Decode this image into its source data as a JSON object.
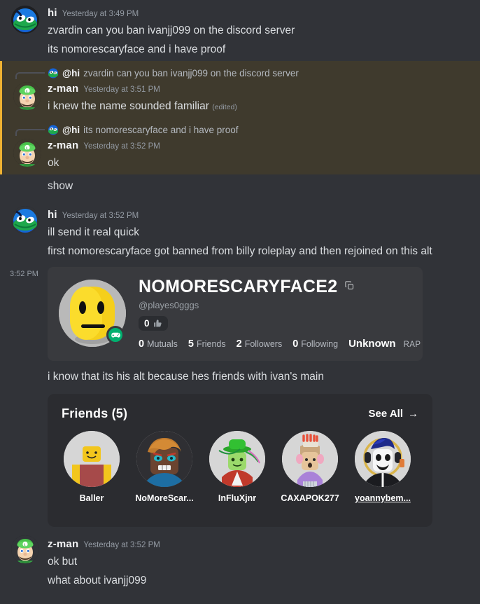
{
  "messages": [
    {
      "id": "m1",
      "author": "hi",
      "timestamp": "Yesterday at 3:49 PM",
      "avatar": "hi-avatar",
      "lines": [
        "zvardin can you ban ivanjj099 on the discord server",
        "its nomorescaryface and i have proof"
      ]
    },
    {
      "id": "m2",
      "author": "z-man",
      "timestamp": "Yesterday at 3:51 PM",
      "avatar": "z-man-avatar",
      "mention": true,
      "reply": {
        "name": "@hi",
        "text": "zvardin can you ban ivanjj099 on the discord server"
      },
      "lines": [
        "i knew the name sounded familiar"
      ],
      "edited": "(edited)"
    },
    {
      "id": "m3",
      "author": "z-man",
      "timestamp": "Yesterday at 3:52 PM",
      "avatar": "z-man-avatar",
      "mention": true,
      "reply": {
        "name": "@hi",
        "text": "its nomorescaryface and i have proof"
      },
      "lines": [
        "ok"
      ]
    },
    {
      "id": "m3b",
      "lines": [
        "show"
      ]
    },
    {
      "id": "m4",
      "author": "hi",
      "timestamp": "Yesterday at 3:52 PM",
      "avatar": "hi-avatar",
      "lines": [
        "ill send it real quick",
        "first nomorescaryface got banned from billy roleplay and then rejoined on this alt"
      ]
    }
  ],
  "embed": {
    "hover_timestamp": "3:52 PM",
    "profile": {
      "display_name": "NOMORESCARYFACE2",
      "handle": "@playes0gggs",
      "like_count": "0",
      "copy_icon": "copy-icon",
      "game_badge_icon": "gamepad-icon",
      "stats": [
        {
          "value": "0",
          "label": "Mutuals"
        },
        {
          "value": "5",
          "label": "Friends"
        },
        {
          "value": "2",
          "label": "Followers"
        },
        {
          "value": "0",
          "label": "Following"
        }
      ],
      "rap_value": "Unknown",
      "rap_label": "RAP"
    }
  },
  "mid_message": {
    "text": "i know that its his alt because hes friends with ivan's main"
  },
  "friends_card": {
    "title": "Friends (5)",
    "see_all": "See All",
    "see_all_arrow": "→",
    "friends": [
      {
        "name": "Baller",
        "underline": false
      },
      {
        "name": "NoMoreScar...",
        "underline": false
      },
      {
        "name": "InFluXjnr",
        "underline": false
      },
      {
        "name": "CAXAPOK277",
        "underline": false
      },
      {
        "name": "yoannybem...",
        "underline": true
      }
    ]
  },
  "final_message": {
    "author": "z-man",
    "timestamp": "Yesterday at 3:52 PM",
    "lines": [
      "ok but",
      "what about ivanjj099"
    ]
  },
  "colors": {
    "background": "#313338",
    "mention_bg": "#3f3a2d",
    "mention_stripe": "#f0b232",
    "embed_bg": "#393a3e",
    "friends_bg": "#2b2c30",
    "text": "#dbdee1",
    "muted": "#949ba4",
    "username": "#f2f3f5",
    "badge_green": "#00b06f"
  }
}
